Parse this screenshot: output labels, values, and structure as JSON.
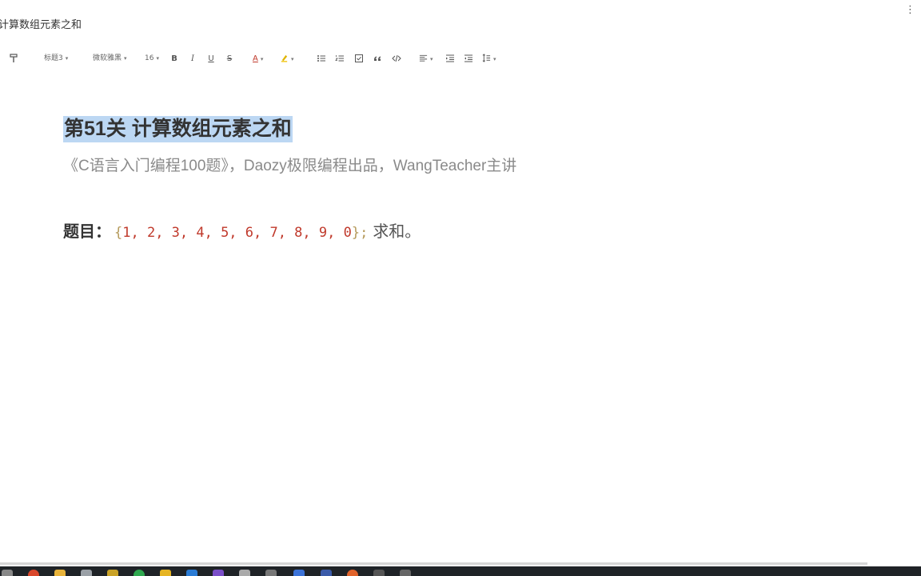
{
  "window": {
    "title": "计算数组元素之和"
  },
  "toolbar": {
    "heading_style": "标题3",
    "font_family": "微软雅黑",
    "font_size": "16",
    "bold_label": "B",
    "italic_label": "I",
    "underline_label": "U",
    "strike_label": "S",
    "font_color_label": "A"
  },
  "document": {
    "heading": "第51关 计算数组元素之和",
    "subtitle": "《C语言入门编程100题》，Daozy极限编程出品，WangTeacher主讲",
    "question": {
      "label": "题目：",
      "array_open": "{",
      "array_values": "1, 2, 3, 4, 5, 6, 7, 8, 9, 0",
      "array_close": "};",
      "tail": "求和。"
    }
  },
  "colors": {
    "selection": "#bcd7f3",
    "array_digits": "#c0392b",
    "taskbar": "#1f2327",
    "active_task": "#3c73d8"
  }
}
